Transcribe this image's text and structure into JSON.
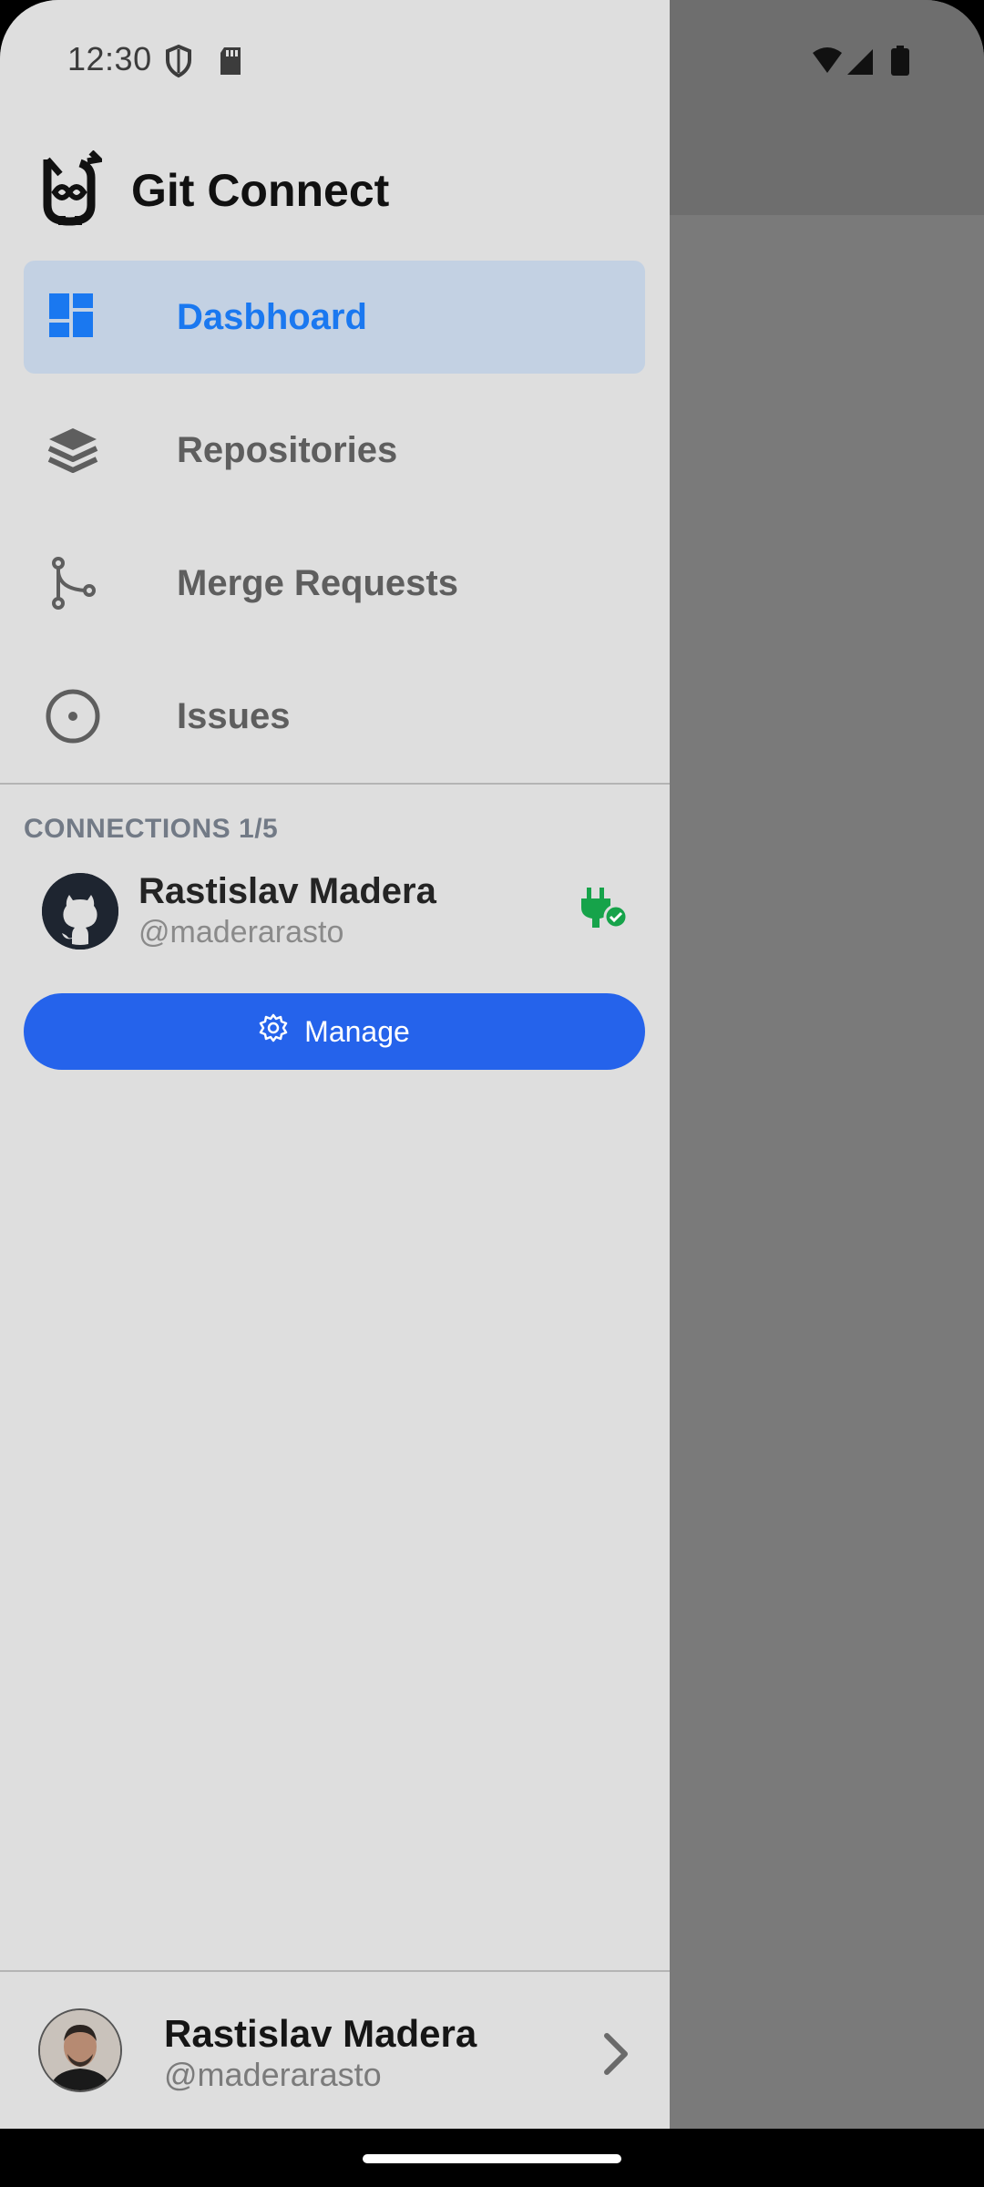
{
  "status_bar": {
    "time": "12:30",
    "left_icons": [
      "shield-icon",
      "sd-card-icon"
    ],
    "right_icons": [
      "wifi-icon",
      "cell-signal-icon",
      "battery-icon"
    ]
  },
  "app": {
    "title": "Git Connect",
    "logo_icon": "git-connect-logo-icon"
  },
  "nav": {
    "items": [
      {
        "label": "Dasbhoard",
        "icon": "dashboard-icon",
        "active": true
      },
      {
        "label": "Repositories",
        "icon": "layers-icon",
        "active": false
      },
      {
        "label": "Merge Requests",
        "icon": "merge-icon",
        "active": false
      },
      {
        "label": "Issues",
        "icon": "issue-circle-icon",
        "active": false
      }
    ]
  },
  "connections": {
    "header": "CONNECTIONS 1/5",
    "items": [
      {
        "name": "Rastislav Madera",
        "handle": "@maderarasto",
        "provider_icon": "github-icon",
        "status_icon": "plug-connected-icon"
      }
    ],
    "manage_label": "Manage",
    "manage_icon": "gear-icon"
  },
  "profile": {
    "name": "Rastislav Madera",
    "handle": "@maderarasto",
    "chevron_icon": "chevron-right-icon"
  },
  "colors": {
    "drawer_bg": "#dedede",
    "active_bg": "#c3d1e3",
    "active_text": "#1a78f0",
    "button_bg": "#2563eb",
    "connected_green": "#16a34a",
    "scrim": "#7a7a7a"
  }
}
